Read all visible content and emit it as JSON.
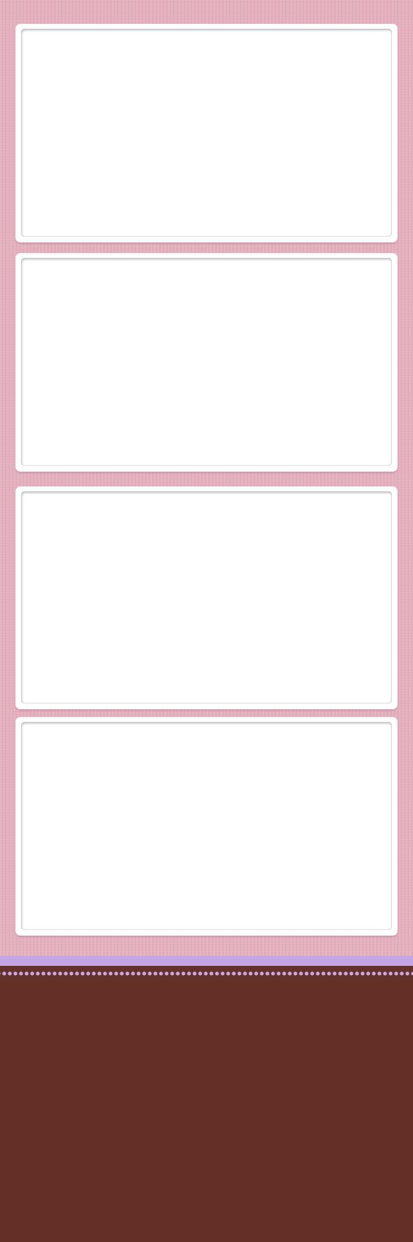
{
  "photo_strip": {
    "frames": [
      {
        "name": "photo-frame-1"
      },
      {
        "name": "photo-frame-2"
      },
      {
        "name": "photo-frame-3"
      },
      {
        "name": "photo-frame-4"
      }
    ]
  },
  "colors": {
    "background_pink": "#e3aebc",
    "frame_white": "#ffffff",
    "band_lavender": "#c3a6e6",
    "dot_lavender": "#cfa7e3",
    "footer_brown": "#632f26"
  }
}
